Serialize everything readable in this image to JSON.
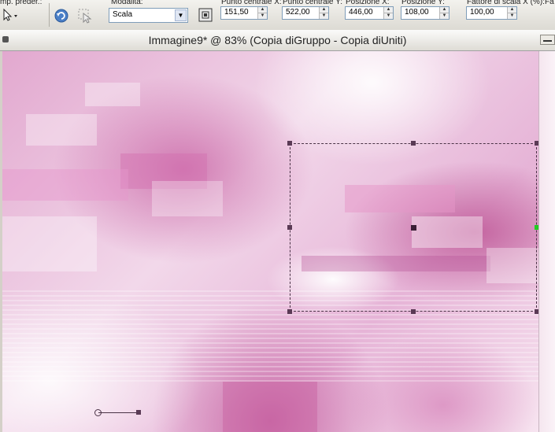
{
  "toolbar": {
    "preset_label": "mp. preder.:",
    "mode_label": "Modalità:",
    "mode_value": "Scala",
    "center_x_label": "Punto centrale X:",
    "center_x_value": "151,50",
    "center_y_label": "Punto centrale Y:",
    "center_y_value": "522,00",
    "pos_x_label": "Posizione X:",
    "pos_x_value": "446,00",
    "pos_y_label": "Posizione Y:",
    "pos_y_value": "108,00",
    "scale_x_label": "Fattore di scala X (%):",
    "scale_x_value": "100,00",
    "extra_label": "Fa"
  },
  "window": {
    "title": "Immagine9* @  83% (Copia diGruppo - Copia diUniti)"
  },
  "colors": {
    "accent_pink": "#c85aa0",
    "selection": "#4a3346",
    "side_handle": "#22cc22"
  }
}
